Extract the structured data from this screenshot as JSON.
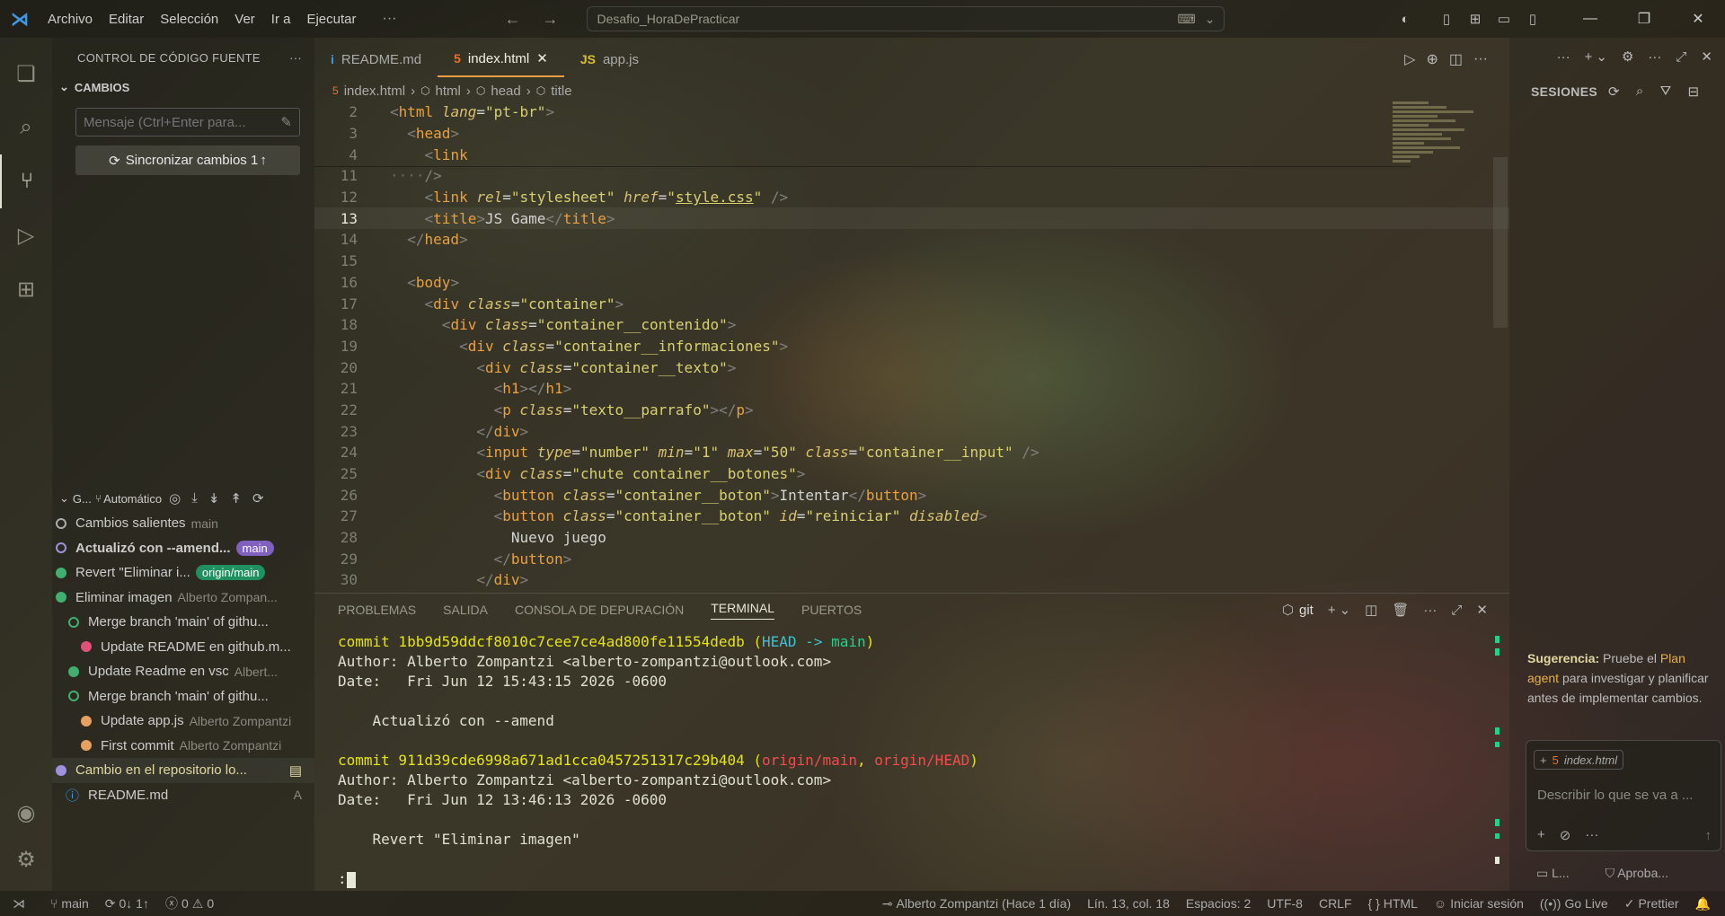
{
  "menu": [
    "Archivo",
    "Editar",
    "Selección",
    "Ver",
    "Ir a",
    "Ejecutar"
  ],
  "command_center": "Desafio_HoraDePracticar",
  "sidebar": {
    "title": "CONTROL DE CÓDIGO FUENTE",
    "changes_label": "CAMBIOS",
    "message_placeholder": "Mensaje (Ctrl+Enter para...",
    "sync_button": "Sincronizar cambios 1",
    "graph_label": "G...",
    "graph_mode": "Automático",
    "graph": [
      {
        "message": "Cambios salientes",
        "author": "main",
        "color": "#aaaaaa",
        "indent": 0,
        "hollow": true
      },
      {
        "message": "Actualizó con --amend...",
        "author": "",
        "badge": "main",
        "badge_color": "#8060c0",
        "color": "#a090e0",
        "indent": 0,
        "hollow": true,
        "bold": true
      },
      {
        "message": "Revert \"Eliminar i...",
        "author": "",
        "badge": "origin/main",
        "badge_color": "#209060",
        "color": "#40b070",
        "indent": 0
      },
      {
        "message": "Eliminar imagen",
        "author": "Alberto Zompan...",
        "color": "#40b070",
        "indent": 0
      },
      {
        "message": "Merge branch 'main' of githu...",
        "author": "",
        "color": "#40b070",
        "indent": 1,
        "hollow": true
      },
      {
        "message": "Update README en github.m...",
        "author": "",
        "color": "#e0507a",
        "indent": 2
      },
      {
        "message": "Update Readme en vsc",
        "author": "Albert...",
        "color": "#40b070",
        "indent": 1
      },
      {
        "message": "Merge branch 'main' of githu...",
        "author": "",
        "color": "#40b070",
        "indent": 1,
        "hollow": true
      },
      {
        "message": "Update app.js",
        "author": "Alberto Zompantzi",
        "color": "#e8a060",
        "indent": 2
      },
      {
        "message": "First commit",
        "author": "Alberto Zompantzi",
        "color": "#e8a060",
        "indent": 2
      },
      {
        "message": "Cambio en el repositorio lo...",
        "author": "",
        "color": "#a090e0",
        "indent": 0,
        "highlight": true
      },
      {
        "message": "README.md",
        "author": "A",
        "color": "#3b9ae8",
        "indent": 1,
        "file": true
      }
    ]
  },
  "tabs": [
    {
      "label": "README.md",
      "icon": "i",
      "icon_color": "#3b9ae8",
      "active": false
    },
    {
      "label": "index.html",
      "icon": "5",
      "icon_color": "#e8702a",
      "active": true
    },
    {
      "label": "app.js",
      "icon": "JS",
      "icon_color": "#d8c030",
      "active": false
    }
  ],
  "breadcrumb": [
    "index.html",
    "html",
    "head",
    "title"
  ],
  "code": [
    {
      "n": "2",
      "html": "<span style='color:#808080'>&lt;</span><span style='color:#e8a040'>html</span> <span style='color:#d8c070;font-style:italic'>lang</span>=<span style='color:#d8d070'>\"pt-br\"</span><span style='color:#808080'>&gt;</span>"
    },
    {
      "n": "3",
      "html": "  <span style='color:#808080'>&lt;</span><span style='color:#e8a040'>head</span><span style='color:#808080'>&gt;</span>"
    },
    {
      "n": "4",
      "html": "    <span style='color:#808080'>&lt;</span><span style='color:#e8a040'>link</span>"
    },
    {
      "n": "11",
      "html": "<span style='color:#6a6a5a'>····</span><span style='color:#808080'>/&gt;</span>"
    },
    {
      "n": "12",
      "html": "    <span style='color:#808080'>&lt;</span><span style='color:#e8a040'>link</span> <span style='color:#d8c070;font-style:italic'>rel</span>=<span style='color:#d8d070'>\"stylesheet\"</span> <span style='color:#d8c070;font-style:italic'>href</span>=<span style='color:#d8d070'>\"<u>style.css</u>\"</span> <span style='color:#808080'>/&gt;</span>"
    },
    {
      "n": "13",
      "html": "    <span style='color:#808080'>&lt;</span><span style='color:#e8a040'>title</span><span style='color:#808080'>&gt;</span>JS Game<span style='color:#808080'>&lt;/</span><span style='color:#e8a040'>title</span><span style='color:#808080'>&gt;</span>",
      "cur": true
    },
    {
      "n": "14",
      "html": "  <span style='color:#808080'>&lt;/</span><span style='color:#e8a040'>head</span><span style='color:#808080'>&gt;</span>"
    },
    {
      "n": "15",
      "html": ""
    },
    {
      "n": "16",
      "html": "  <span style='color:#808080'>&lt;</span><span style='color:#e8a040'>body</span><span style='color:#808080'>&gt;</span>"
    },
    {
      "n": "17",
      "html": "    <span style='color:#808080'>&lt;</span><span style='color:#e8a040'>div</span> <span style='color:#d8c070;font-style:italic'>class</span>=<span style='color:#d8d070'>\"container\"</span><span style='color:#808080'>&gt;</span>"
    },
    {
      "n": "18",
      "html": "      <span style='color:#808080'>&lt;</span><span style='color:#e8a040'>div</span> <span style='color:#d8c070;font-style:italic'>class</span>=<span style='color:#d8d070'>\"container__contenido\"</span><span style='color:#808080'>&gt;</span>"
    },
    {
      "n": "19",
      "html": "        <span style='color:#808080'>&lt;</span><span style='color:#e8a040'>div</span> <span style='color:#d8c070;font-style:italic'>class</span>=<span style='color:#d8d070'>\"container__informaciones\"</span><span style='color:#808080'>&gt;</span>"
    },
    {
      "n": "20",
      "html": "          <span style='color:#808080'>&lt;</span><span style='color:#e8a040'>div</span> <span style='color:#d8c070;font-style:italic'>class</span>=<span style='color:#d8d070'>\"container__texto\"</span><span style='color:#808080'>&gt;</span>"
    },
    {
      "n": "21",
      "html": "            <span style='color:#808080'>&lt;</span><span style='color:#e8a040'>h1</span><span style='color:#808080'>&gt;&lt;/</span><span style='color:#e8a040'>h1</span><span style='color:#808080'>&gt;</span>"
    },
    {
      "n": "22",
      "html": "            <span style='color:#808080'>&lt;</span><span style='color:#e8a040'>p</span> <span style='color:#d8c070;font-style:italic'>class</span>=<span style='color:#d8d070'>\"texto__parrafo\"</span><span style='color:#808080'>&gt;&lt;/</span><span style='color:#e8a040'>p</span><span style='color:#808080'>&gt;</span>"
    },
    {
      "n": "23",
      "html": "          <span style='color:#808080'>&lt;/</span><span style='color:#e8a040'>div</span><span style='color:#808080'>&gt;</span>"
    },
    {
      "n": "24",
      "html": "          <span style='color:#808080'>&lt;</span><span style='color:#e8a040'>input</span> <span style='color:#d8c070;font-style:italic'>type</span>=<span style='color:#d8d070'>\"number\"</span> <span style='color:#d8c070;font-style:italic'>min</span>=<span style='color:#d8d070'>\"1\"</span> <span style='color:#d8c070;font-style:italic'>max</span>=<span style='color:#d8d070'>\"50\"</span> <span style='color:#d8c070;font-style:italic'>class</span>=<span style='color:#d8d070'>\"container__input\"</span> <span style='color:#808080'>/&gt;</span>"
    },
    {
      "n": "25",
      "html": "          <span style='color:#808080'>&lt;</span><span style='color:#e8a040'>div</span> <span style='color:#d8c070;font-style:italic'>class</span>=<span style='color:#d8d070'>\"chute container__botones\"</span><span style='color:#808080'>&gt;</span>"
    },
    {
      "n": "26",
      "html": "            <span style='color:#808080'>&lt;</span><span style='color:#e8a040'>button</span> <span style='color:#d8c070;font-style:italic'>class</span>=<span style='color:#d8d070'>\"container__boton\"</span><span style='color:#808080'>&gt;</span>Intentar<span style='color:#808080'>&lt;/</span><span style='color:#e8a040'>button</span><span style='color:#808080'>&gt;</span>"
    },
    {
      "n": "27",
      "html": "            <span style='color:#808080'>&lt;</span><span style='color:#e8a040'>button</span> <span style='color:#d8c070;font-style:italic'>class</span>=<span style='color:#d8d070'>\"container__boton\"</span> <span style='color:#d8c070;font-style:italic'>id</span>=<span style='color:#d8d070'>\"reiniciar\"</span> <span style='color:#d8c070;font-style:italic'>disabled</span><span style='color:#808080'>&gt;</span>"
    },
    {
      "n": "28",
      "html": "              Nuevo juego"
    },
    {
      "n": "29",
      "html": "            <span style='color:#808080'>&lt;/</span><span style='color:#e8a040'>button</span><span style='color:#808080'>&gt;</span>"
    },
    {
      "n": "30",
      "html": "          <span style='color:#808080'>&lt;/</span><span style='color:#e8a040'>div</span><span style='color:#808080'>&gt;</span>"
    }
  ],
  "panel": {
    "tabs": [
      "PROBLEMAS",
      "SALIDA",
      "CONSOLA DE DEPURACIÓN",
      "TERMINAL",
      "PUERTOS"
    ],
    "active_tab": "TERMINAL",
    "shell": "git",
    "terminal": [
      {
        "parts": [
          {
            "t": "commit 1bb9d59ddcf8010c7cee7ce4ad800fe11554dedb (",
            "c": "t-yellow"
          },
          {
            "t": "HEAD -> ",
            "c": "t-cyan"
          },
          {
            "t": "main",
            "c": "t-green"
          },
          {
            "t": ")",
            "c": "t-yellow"
          }
        ]
      },
      {
        "parts": [
          {
            "t": "Author: Alberto Zompantzi <alberto-zompantzi@outlook.com>",
            "c": ""
          }
        ]
      },
      {
        "parts": [
          {
            "t": "Date:   Fri Jun 12 15:43:15 2026 -0600",
            "c": ""
          }
        ]
      },
      {
        "parts": [
          {
            "t": "",
            "c": ""
          }
        ]
      },
      {
        "parts": [
          {
            "t": "    Actualizó con --amend",
            "c": ""
          }
        ]
      },
      {
        "parts": [
          {
            "t": "",
            "c": ""
          }
        ]
      },
      {
        "parts": [
          {
            "t": "commit 911d39cde6998a671ad1cca0457251317c29b404 (",
            "c": "t-yellow"
          },
          {
            "t": "origin/main",
            "c": "t-red"
          },
          {
            "t": ", ",
            "c": "t-yellow"
          },
          {
            "t": "origin/HEAD",
            "c": "t-red"
          },
          {
            "t": ")",
            "c": "t-yellow"
          }
        ]
      },
      {
        "parts": [
          {
            "t": "Author: Alberto Zompantzi <alberto-zompantzi@outlook.com>",
            "c": ""
          }
        ]
      },
      {
        "parts": [
          {
            "t": "Date:   Fri Jun 12 13:46:13 2026 -0600",
            "c": ""
          }
        ]
      },
      {
        "parts": [
          {
            "t": "",
            "c": ""
          }
        ]
      },
      {
        "parts": [
          {
            "t": "    Revert \"Eliminar imagen\"",
            "c": ""
          }
        ]
      },
      {
        "parts": [
          {
            "t": "",
            "c": ""
          }
        ]
      },
      {
        "parts": [
          {
            "t": ":",
            "c": ""
          }
        ],
        "cursor": true
      }
    ]
  },
  "right_panel": {
    "title": "SESIONES",
    "suggestion_label": "Sugerencia:",
    "suggestion_pre": "Pruebe el",
    "suggestion_link": "Plan agent",
    "suggestion_post": "para investigar y planificar antes de implementar cambios.",
    "context_chip": "index.html",
    "chat_placeholder": "Describir lo que se va a ...",
    "footer_left": "L...",
    "footer_right": "Aproba..."
  },
  "status": {
    "branch": "main",
    "sync": "0↓ 1↑",
    "errors": "0",
    "warnings": "0",
    "blame": "Alberto Zompantzi (Hace 1 día)",
    "position": "Lín. 13, col. 18",
    "spaces": "Espacios: 2",
    "encoding": "UTF-8",
    "eol": "CRLF",
    "language": "HTML",
    "signin": "Iniciar sesión",
    "golive": "Go Live",
    "prettier": "Prettier"
  }
}
